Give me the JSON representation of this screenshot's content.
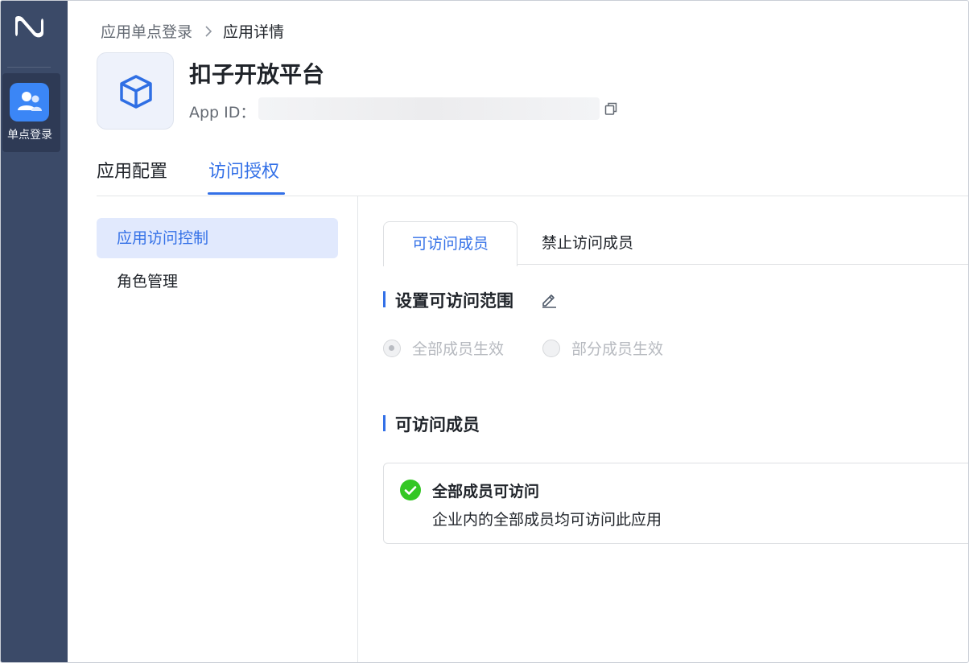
{
  "rail": {
    "logo_icon": "brand-logo-icon",
    "app_label": "单点登录",
    "app_icon": "users-icon"
  },
  "breadcrumb": {
    "parent": "应用单点登录",
    "current": "应用详情"
  },
  "app": {
    "name": "扣子开放平台",
    "id_label": "App ID：",
    "icon": "cube-icon"
  },
  "main_tabs": [
    {
      "label": "应用配置",
      "active": false
    },
    {
      "label": "访问授权",
      "active": true
    }
  ],
  "side_menu": [
    {
      "label": "应用访问控制",
      "active": true
    },
    {
      "label": "角色管理",
      "active": false
    }
  ],
  "sub_tabs": [
    {
      "label": "可访问成员",
      "active": true
    },
    {
      "label": "禁止访问成员",
      "active": false
    }
  ],
  "scope_section": {
    "title": "设置可访问范围",
    "options": [
      {
        "label": "全部成员生效",
        "selected": true
      },
      {
        "label": "部分成员生效",
        "selected": false
      }
    ]
  },
  "members_section": {
    "title": "可访问成员",
    "card_title": "全部成员可访问",
    "card_desc": "企业内的全部成员均可访问此应用"
  },
  "colors": {
    "accent": "#3370e7",
    "rail": "#3b4a68",
    "success": "#34c724"
  }
}
